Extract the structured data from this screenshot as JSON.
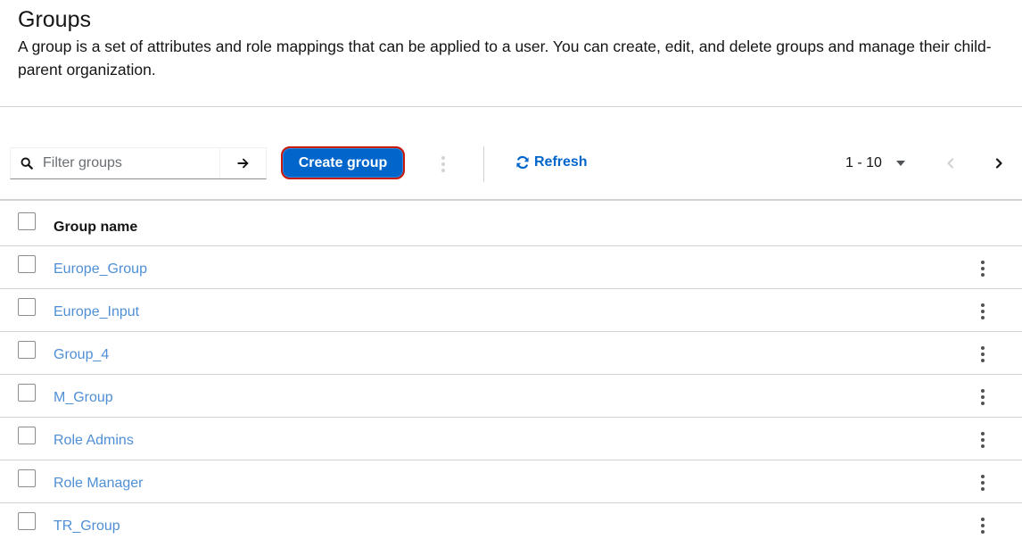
{
  "header": {
    "title": "Groups",
    "description": "A group is a set of attributes and role mappings that can be applied to a user. You can create, edit, and delete groups and manage their child-parent organization."
  },
  "toolbar": {
    "search": {
      "placeholder": "Filter groups",
      "value": ""
    },
    "create_label": "Create group",
    "refresh_label": "Refresh",
    "pagination": {
      "range": "1 - 10"
    }
  },
  "table": {
    "column_header": "Group name",
    "rows": [
      {
        "name": "Europe_Group"
      },
      {
        "name": "Europe_Input"
      },
      {
        "name": "Group_4"
      },
      {
        "name": "M_Group"
      },
      {
        "name": "Role Admins"
      },
      {
        "name": "Role Manager"
      },
      {
        "name": "TR_Group"
      }
    ]
  },
  "colors": {
    "primary": "#0066cc",
    "link": "#4f8fd6",
    "highlight_border": "#c9190b",
    "divider": "#d2d2d2"
  },
  "icons": {
    "search": "search-icon",
    "go": "arrow-right-icon",
    "toolbar_kebab": "kebab-icon",
    "refresh": "sync-icon",
    "per_page": "caret-down-icon",
    "prev": "angle-left-icon",
    "next": "angle-right-icon",
    "row_actions": "kebab-icon"
  }
}
